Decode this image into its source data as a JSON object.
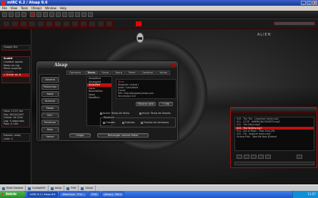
{
  "window": {
    "title": "mIRC 6.2 / Alsap 8.6",
    "buttons": [
      "_",
      "□",
      "x"
    ]
  },
  "menu": [
    "File",
    "View",
    "Tools",
    "[Alsap]",
    "Window",
    "Help"
  ],
  "brand": "ALIEN",
  "sidebar": {
    "top_label": "Google Dre",
    "box1_title": "Scobit",
    "box1_lines": [
      "Cambiar apodo",
      "Modo ira reg",
      "Poner ausente",
      "Canales"
    ],
    "box1_hl": "> Entrar en #",
    "box2_lines": [
      "Hora: 11:57 am",
      "Dia: 28/10/2007",
      "Online: 0h 25m",
      "Lag: 0 segundos",
      "Pass: 0 nick"
    ],
    "box3_lines": [
      "Estado: ready",
      "Lista: 0"
    ]
  },
  "dialog": {
    "title": "Alsap",
    "nav": [
      "General",
      "Proteccion",
      "Away",
      "Scheme",
      "Media",
      "DCC",
      "Emoticon",
      "Bots",
      "Varios"
    ],
    "tabs": [
      "Opciones",
      "Temas",
      "Sonar",
      "Barra",
      "Panel",
      "Canalbar",
      "Varios"
    ],
    "themes": [
      "AlsapBlue",
      "Alsapgold",
      "AlsapRed",
      "Aqua",
      "BlackWhite",
      "Neon",
      "NewBlue"
    ],
    "selected_theme": "AlsapRed",
    "info_title": "Tema",
    "info_lines": [
      "Alsapred ( actual )",
      "Autor: Consultant",
      "E-mail:",
      "URL: http://Alsapred.jimdo.com",
      "Ver.version: 6.0",
      "Dim theme: Red"
    ],
    "preview_label": "Mostrar web",
    "info_label": "+ Info",
    "check_text_theme": "Incluir Tema de Texto",
    "check_sound_theme": "Incluir Tema de Sonido",
    "group_label": "Restaurar",
    "check_colors": "Colores",
    "check_fonts": "Fuentes",
    "check_windows": "Fondos de ventanas",
    "load_button": "Cargar",
    "download_button": "Descargar nuevos tletas"
  },
  "playlist": {
    "items": [
      "019 - The The - Uncertain Smile.mp3",
      "011 - CCCP - AMERICAN SOVIETS.mp3",
      "012 - The Disco.mp3",
      "013 - The Smiths.mp3",
      "014 - Ark of Moon - Peas Sure [Re",
      "015 - OG - Spanish morn.mp3",
      "Vicious Pink - Take Me Now [Extend"
    ],
    "playing_index": 3
  },
  "taskbar_top": [
    "Nuke Dairoke",
    "fuckball95",
    "setup",
    "PLM",
    "Unisal"
  ],
  "taskbar": {
    "start": "Inicio",
    "tasks": [
      "mIRC 6.2 / Alsap 8.6",
      "Warmicon - Prin...",
      "PLM",
      "[Alsap] - Paint"
    ],
    "active_index": 0,
    "clock": "11:57"
  }
}
